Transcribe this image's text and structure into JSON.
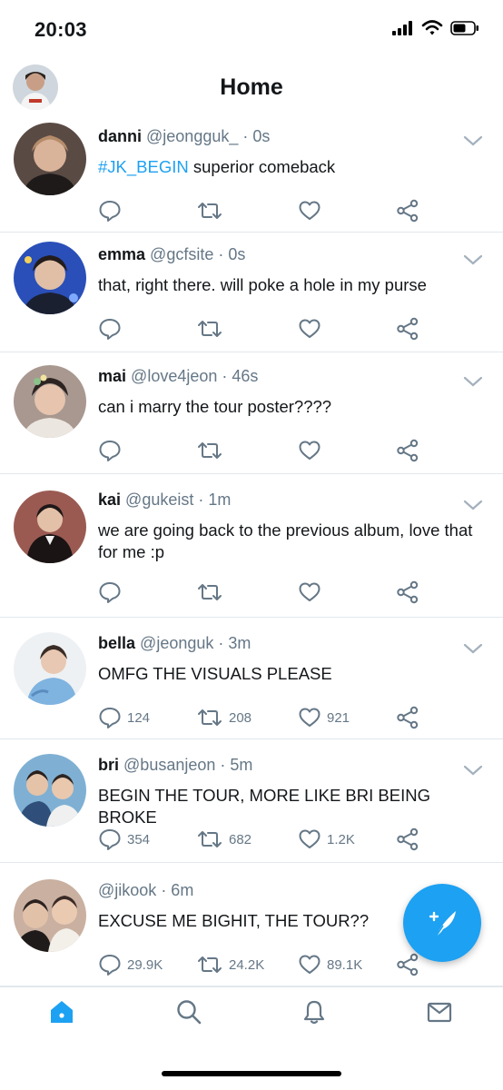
{
  "status_bar": {
    "time": "20:03"
  },
  "header": {
    "title": "Home"
  },
  "tweets": [
    {
      "name": "danni",
      "handle": "@jeongguk_",
      "time": "· 0s",
      "hashtag": "#JK_BEGIN",
      "text": " superior comeback",
      "replies": "",
      "retweets": "",
      "likes": ""
    },
    {
      "name": "emma",
      "handle": "@gcfsite",
      "time": "· 0s",
      "hashtag": "",
      "text": "that, right there. will poke a hole in my purse",
      "replies": "",
      "retweets": "",
      "likes": ""
    },
    {
      "name": "mai",
      "handle": "@love4jeon",
      "time": "· 46s",
      "hashtag": "",
      "text": "can i marry the tour poster????",
      "replies": "",
      "retweets": "",
      "likes": ""
    },
    {
      "name": "kai",
      "handle": "@gukeist",
      "time": "· 1m",
      "hashtag": "",
      "text": "we are going back to the previous album, love that for me :p",
      "replies": "",
      "retweets": "",
      "likes": ""
    },
    {
      "name": "bella",
      "handle": "@jeonguk",
      "time": "· 3m",
      "hashtag": "",
      "text": "OMFG THE VISUALS PLEASE",
      "replies": "124",
      "retweets": "208",
      "likes": "921"
    },
    {
      "name": "bri",
      "handle": "@busanjeon",
      "time": "· 5m",
      "hashtag": "",
      "text": "BEGIN THE TOUR, MORE LIKE BRI BEING BROKE",
      "replies": "354",
      "retweets": "682",
      "likes": "1.2K"
    },
    {
      "name": "",
      "handle": "@jikook",
      "time": "· 6m",
      "hashtag": "",
      "text": "EXCUSE ME BIGHIT, THE TOUR??",
      "replies": "29.9K",
      "retweets": "24.2K",
      "likes": "89.1K"
    }
  ],
  "icons": {
    "reply": "reply-icon",
    "retweet": "retweet-icon",
    "like": "heart-icon",
    "share": "share-icon",
    "chevron": "chevron-down-icon",
    "compose": "compose-tweet-icon",
    "tabs": [
      "home-icon",
      "search-icon",
      "notifications-bell-icon",
      "messages-envelope-icon"
    ]
  },
  "colors": {
    "accent": "#1da1f2",
    "icon_gray": "#657786",
    "divider": "#e1e8ed",
    "text": "#14171a"
  }
}
